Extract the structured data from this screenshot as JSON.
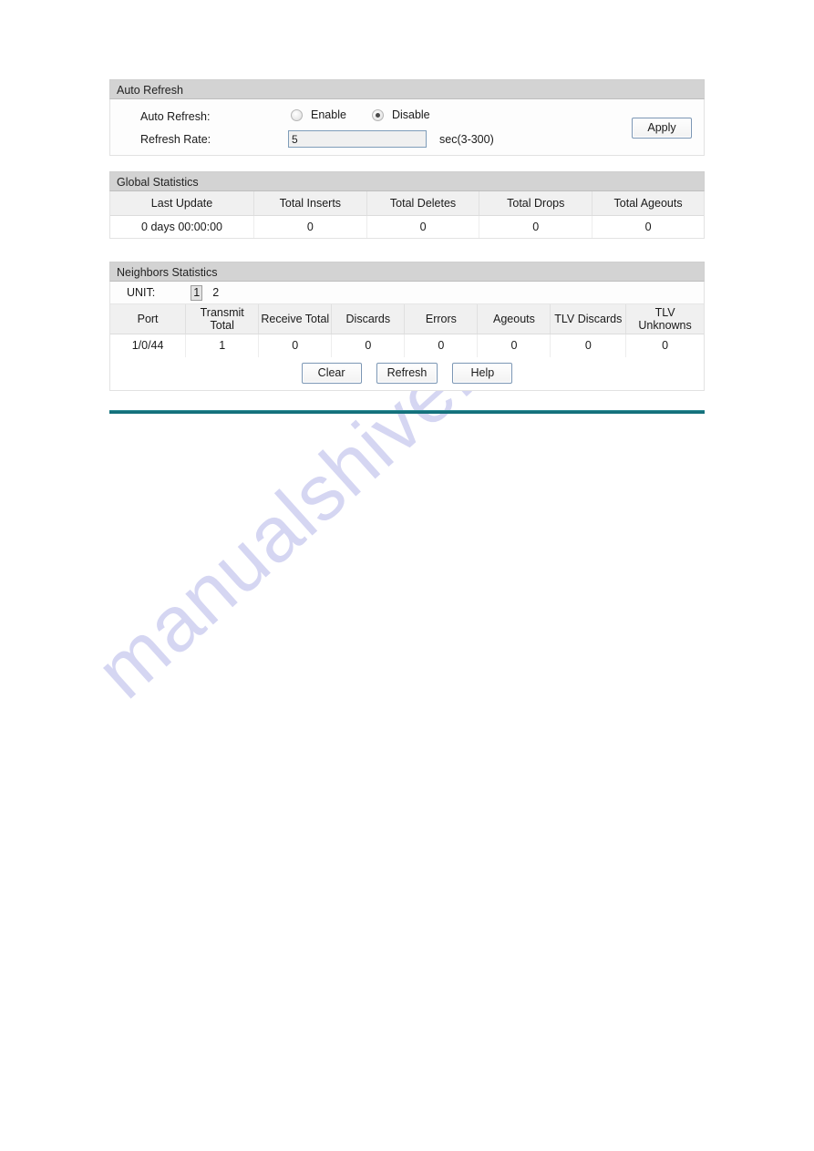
{
  "auto_refresh": {
    "panel_title": "Auto Refresh",
    "field_label": "Auto Refresh:",
    "options": [
      {
        "label": "Enable",
        "selected": false
      },
      {
        "label": "Disable",
        "selected": true
      }
    ],
    "rate_label": "Refresh Rate:",
    "rate_value": "5",
    "rate_placeholder": "",
    "rate_unit": "sec(3-300)",
    "apply_label": "Apply"
  },
  "global_statistics": {
    "panel_title": "Global Statistics",
    "columns": [
      "Last Update",
      "Total Inserts",
      "Total Deletes",
      "Total Drops",
      "Total Ageouts"
    ],
    "rows": [
      [
        "0 days 00:00:00",
        "0",
        "0",
        "0",
        "0"
      ]
    ]
  },
  "neighbors_statistics": {
    "panel_title": "Neighbors Statistics",
    "unit_label": "UNIT:",
    "units": [
      {
        "label": "1",
        "selected": true
      },
      {
        "label": "2",
        "selected": false
      }
    ],
    "columns": [
      "Port",
      "Transmit Total",
      "Receive Total",
      "Discards",
      "Errors",
      "Ageouts",
      "TLV Discards",
      "TLV Unknowns"
    ],
    "rows": [
      [
        "1/0/44",
        "1",
        "0",
        "0",
        "0",
        "0",
        "0",
        "0"
      ]
    ],
    "buttons": [
      {
        "label": "Clear"
      },
      {
        "label": "Refresh"
      },
      {
        "label": "Help"
      }
    ]
  },
  "watermark": {
    "text": "manualshive.com"
  },
  "colors": {
    "panel_header_bg": "#d3d3d3",
    "table_header_bg": "#f0f0f0",
    "rule": "#14707b",
    "input_border": "#7f9db9",
    "watermark": "#c8c9ee"
  }
}
